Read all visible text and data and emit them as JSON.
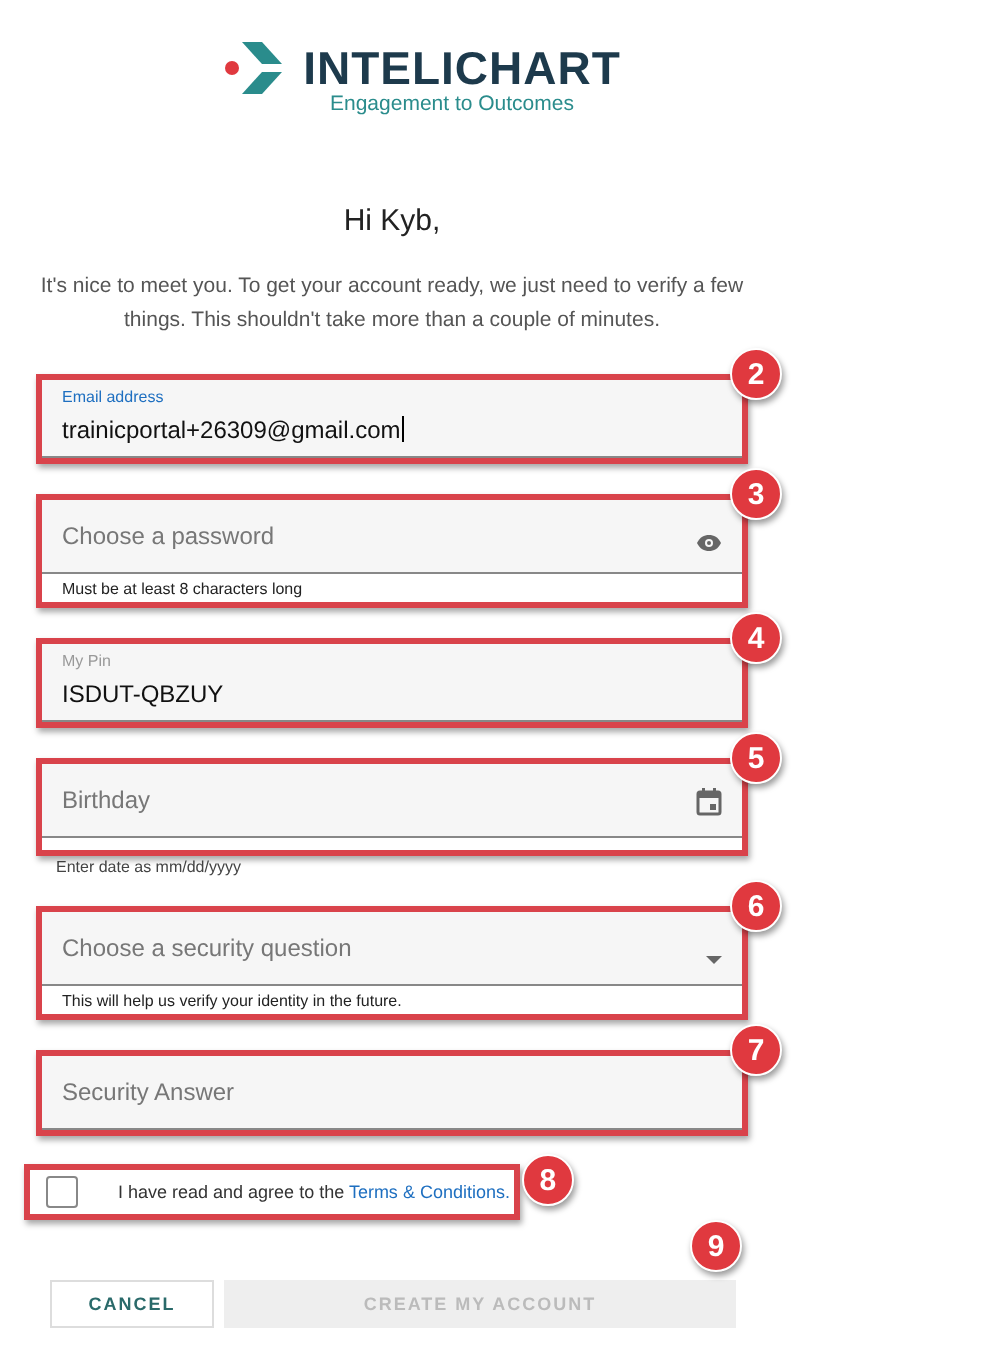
{
  "logo": {
    "name": "INTELICHART",
    "tagline": "Engagement to Outcomes"
  },
  "greeting": "Hi Kyb,",
  "intro": "It's nice to meet you. To get your account ready, we just need to verify a few things. This shouldn't take more than a couple of minutes.",
  "fields": [
    {
      "kind": "text",
      "label": "Email address",
      "value": "trainicportal+26309@gmail.com",
      "focused": true,
      "badge": "2"
    },
    {
      "kind": "password",
      "placeholder": "Choose a password",
      "hint": "Must be at least 8 characters long",
      "focused": false,
      "badge": "3"
    },
    {
      "kind": "text",
      "label": "My Pin",
      "value": "ISDUT-QBZUY",
      "focused": false,
      "badge": "4"
    },
    {
      "kind": "date",
      "placeholder": "Birthday",
      "hint": "Enter date as mm/dd/yyyy",
      "focused": false,
      "badge": "5"
    },
    {
      "kind": "select",
      "placeholder": "Choose a security question",
      "hint": "This will help us verify your identity in the future.",
      "focused": false,
      "badge": "6"
    },
    {
      "kind": "text",
      "placeholder": "Security Answer",
      "focused": false,
      "badge": "7"
    }
  ],
  "agreement": {
    "text": "I have read and agree to the",
    "link": "Terms & Conditions.",
    "checked": false,
    "badge": "8"
  },
  "buttons": [
    {
      "kind": "secondary",
      "label": "CANCEL"
    },
    {
      "kind": "primary",
      "label": "CREATE MY ACCOUNT",
      "disabled": true,
      "badge": "9"
    }
  ]
}
